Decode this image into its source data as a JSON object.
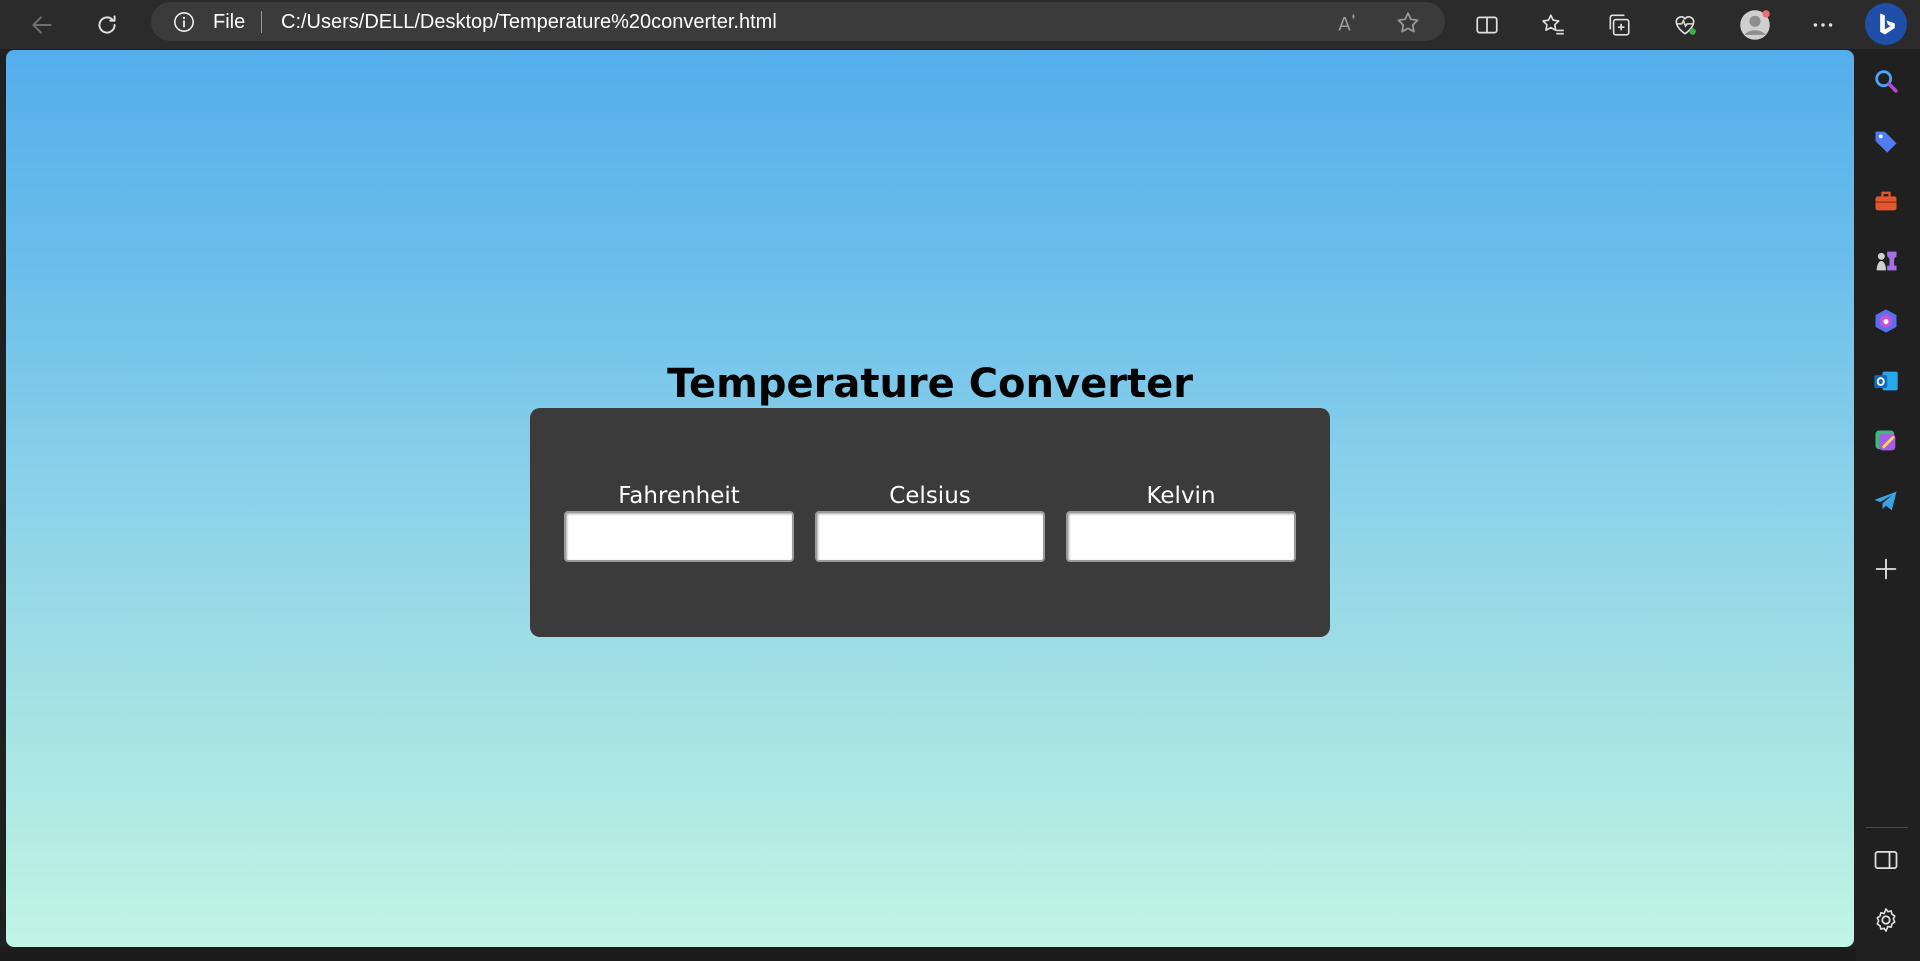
{
  "browser": {
    "address_bar": {
      "scheme_label": "File",
      "url": "C:/Users/DELL/Desktop/Temperature%20converter.html"
    },
    "toolbar_icons": [
      "back-icon",
      "refresh-icon",
      "info-icon",
      "read-aloud-icon",
      "favorite-star-icon",
      "split-screen-icon",
      "favorites-icon",
      "collections-icon",
      "browser-essentials-icon",
      "profile-avatar-icon",
      "more-menu-icon",
      "bing-copilot-icon"
    ],
    "sidebar_icons": [
      "search-icon",
      "shopping-tag-icon",
      "tools-icon",
      "games-icon",
      "microsoft-365-icon",
      "outlook-icon",
      "designer-icon",
      "telegram-icon",
      "add-icon",
      "hide-sidebar-icon",
      "settings-icon"
    ]
  },
  "page": {
    "title": "Temperature Converter",
    "fields": [
      {
        "label": "Fahrenheit",
        "value": ""
      },
      {
        "label": "Celsius",
        "value": ""
      },
      {
        "label": "Kelvin",
        "value": ""
      }
    ]
  },
  "colors": {
    "gradient_top": "#54aeeb",
    "gradient_bottom": "#c1f5e5",
    "card_background": "#3b3b3b",
    "browser_chrome": "#2b2b2b"
  }
}
